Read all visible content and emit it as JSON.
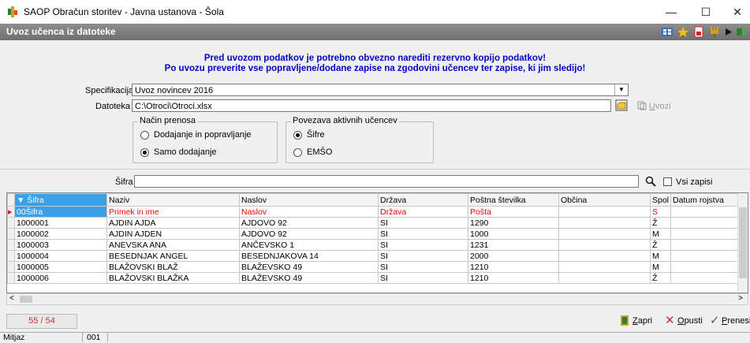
{
  "window": {
    "title": "SAOP Obračun storitev - Javna ustanova - Šola",
    "min": "—",
    "max": "☐",
    "close": "✕"
  },
  "header": {
    "title": "Uvoz učenca iz datoteke"
  },
  "warning": {
    "line1": "Pred uvozom podatkov je potrebno obvezno narediti rezervno kopijo podatkov!",
    "line2": "Po uvozu preverite vse popravljene/dodane zapise na zgodovini učencev ter zapise, ki jim sledijo!"
  },
  "form": {
    "spec_label": "Specifikacija",
    "spec_value": "Uvoz novincev 2016",
    "file_label": "Datoteka",
    "file_value": "C:\\Otroci\\Otroci.xlsx",
    "import_label": "Uvozi"
  },
  "transfer": {
    "title": "Način prenosa",
    "opt1": "Dodajanje in popravljanje",
    "opt2": "Samo dodajanje",
    "selected": "Samo dodajanje"
  },
  "link": {
    "title": "Povezava aktivnih učencev",
    "opt1": "Šifre",
    "opt2": "EMŠO",
    "selected": "Šifre"
  },
  "filter": {
    "label": "Šifra",
    "value": "",
    "all_label": "Vsi zapisi"
  },
  "table": {
    "columns": [
      "▼ Šifra",
      "Naziv",
      "Naslov",
      "Država",
      "Poštna številka",
      "Občina",
      "Spol",
      "Datum rojstva"
    ],
    "rows": [
      [
        "00Šifra",
        "Primek in ime",
        "Naslov",
        "Država",
        "Pošta",
        "",
        "S",
        ""
      ],
      [
        "1000001",
        "AJDIN AJDA",
        "AJDOVO 92",
        "SI",
        "1290",
        "",
        "Ž",
        ""
      ],
      [
        "1000002",
        "AJDIN AJDEN",
        "AJDOVO 92",
        "SI",
        "1000",
        "",
        "M",
        ""
      ],
      [
        "1000003",
        "ANEVSKA ANA",
        "ANČEVSKO 1",
        "SI",
        "1231",
        "",
        "Ž",
        ""
      ],
      [
        "1000004",
        "BESEDNJAK ANGEL",
        "BESEDNJAKOVA 14",
        "SI",
        "2000",
        "",
        "M",
        ""
      ],
      [
        "1000005",
        "BLAŽOVSKI BLAŽ",
        "BLAŽEVSKO 49",
        "SI",
        "1210",
        "",
        "M",
        ""
      ],
      [
        "1000006",
        "BLAŽOVSKI BLAŽKA",
        "BLAŽEVSKO 49",
        "SI",
        "1210",
        "",
        "Ž",
        ""
      ]
    ]
  },
  "footer": {
    "count": "55 / 54",
    "close_label": "Zapri",
    "cancel_label": "Opusti",
    "transfer_label": "Prenesi"
  },
  "status": {
    "user": "Mitjaz",
    "code": "001"
  },
  "colors": {
    "accent": "#3aa0e8",
    "warning": "#0000cc",
    "error": "#ff0000"
  }
}
